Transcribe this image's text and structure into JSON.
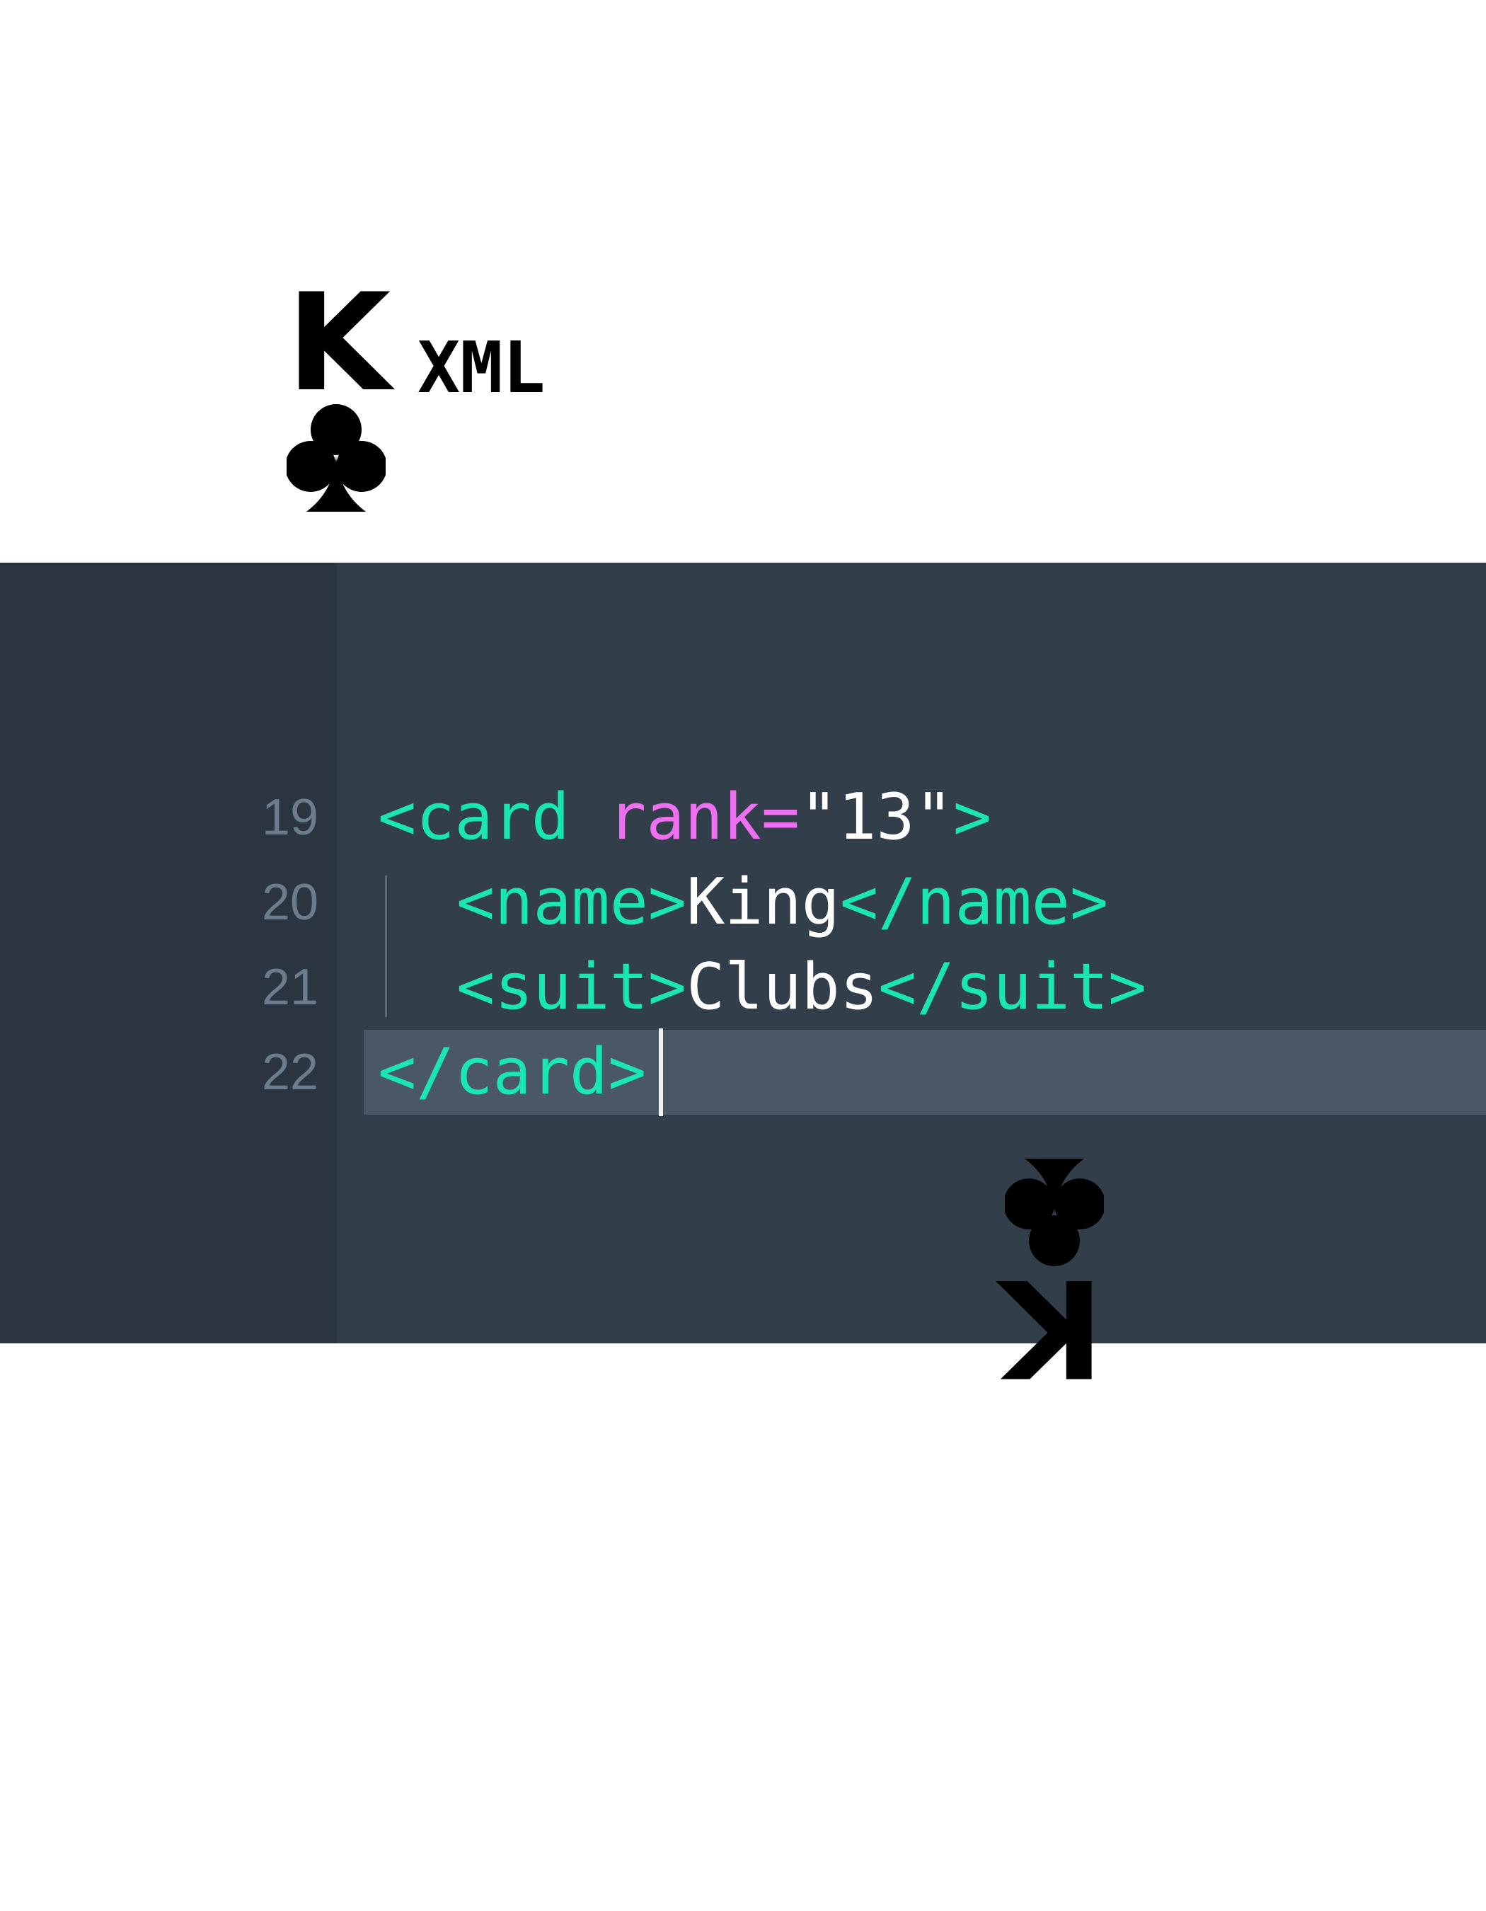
{
  "card": {
    "rank": "K",
    "label": "XML",
    "suit_icon": "club-icon"
  },
  "editor": {
    "lines": [
      {
        "number": "19",
        "tag_open": "<card",
        "attr_name": "rank=",
        "attr_value": "\"13\"",
        "tag_close": ">"
      },
      {
        "number": "20",
        "open_tag": "<name>",
        "text": "King",
        "close_tag": "</name>"
      },
      {
        "number": "21",
        "open_tag": "<suit>",
        "text": "Clubs",
        "close_tag": "</suit>"
      },
      {
        "number": "22",
        "close_tag": "</card>"
      }
    ],
    "colors": {
      "background": "#323f4b",
      "gutter": "#2a3540",
      "active_line": "#4a5866",
      "tag": "#19e6b0",
      "attribute": "#ee6ff0",
      "text": "#ffffff",
      "line_number": "#6b7d8d"
    }
  }
}
